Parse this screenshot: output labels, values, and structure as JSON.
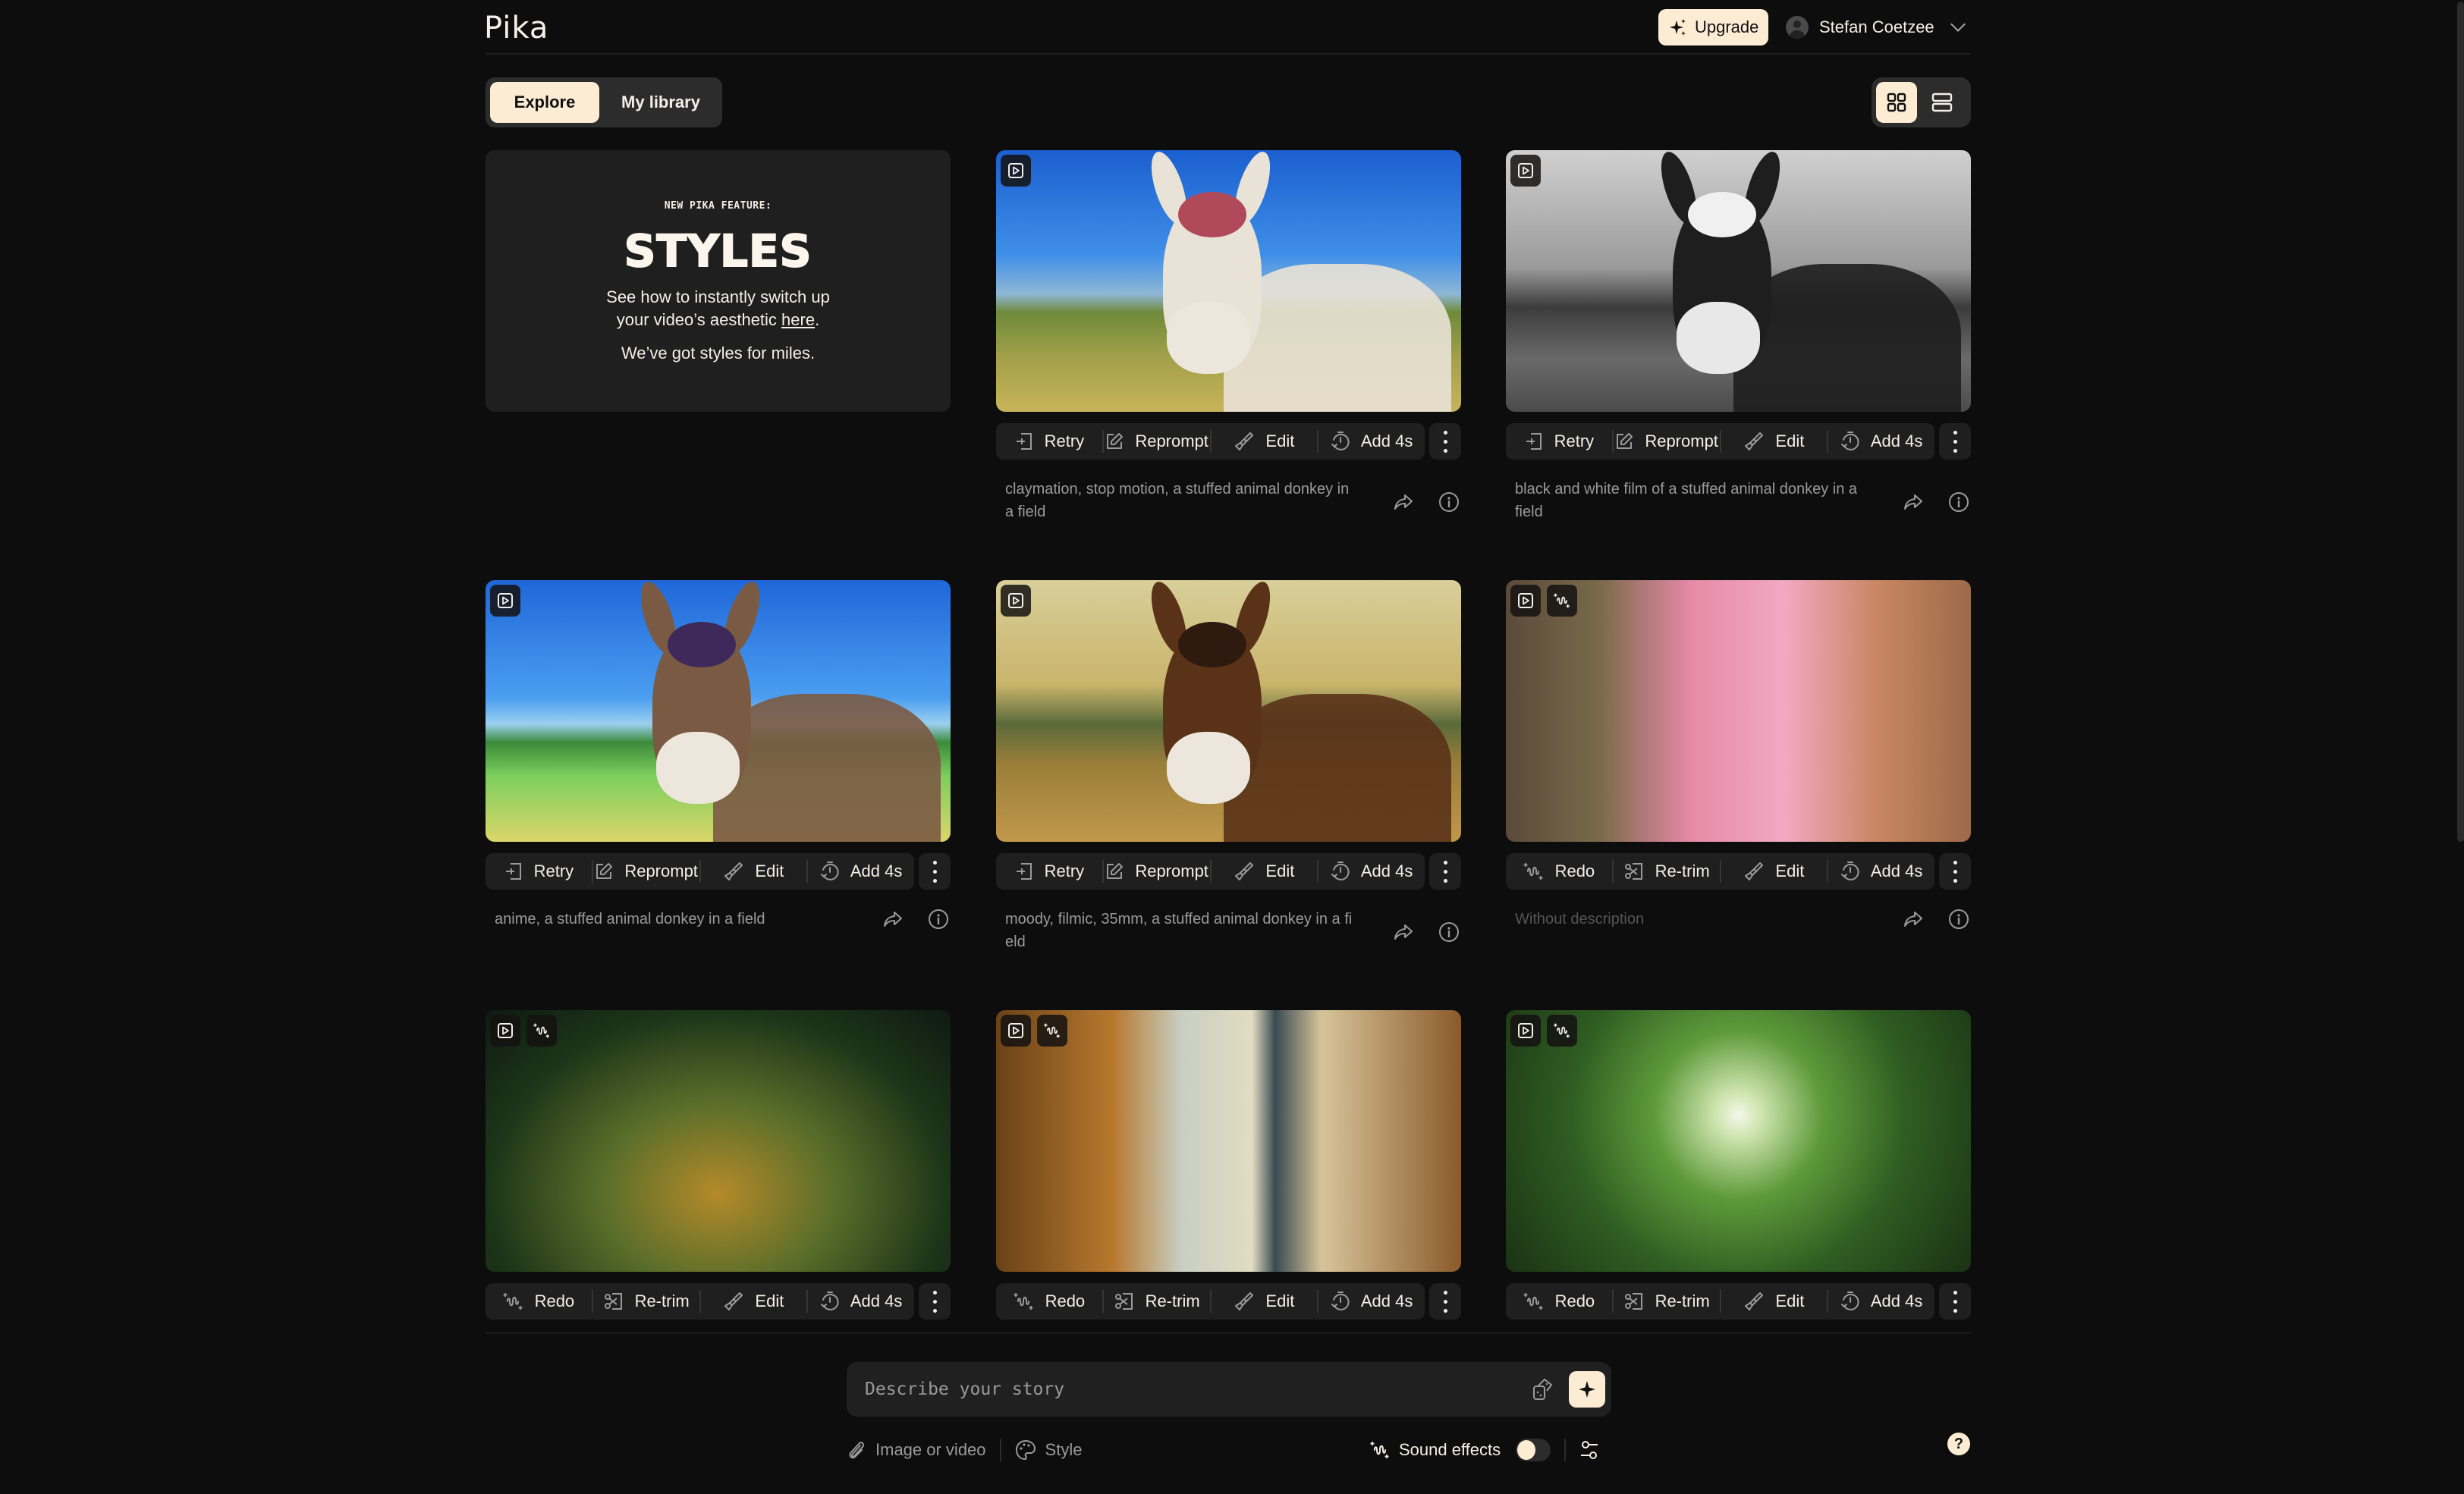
{
  "app": {
    "logo": "Pika",
    "upgrade_label": "Upgrade",
    "user_name": "Stefan Coetzee"
  },
  "tabs": [
    {
      "label": "Explore",
      "active": true
    },
    {
      "label": "My library",
      "active": false
    }
  ],
  "view_toggle": {
    "active": "grid",
    "options": [
      "grid-view",
      "list-view"
    ]
  },
  "promo": {
    "kicker": "NEW PIKA FEATURE:",
    "title": "STYLES",
    "body_line1": "See how to instantly switch up",
    "body_line2_prefix": "your video’s aesthetic ",
    "link": "here",
    "body_line2_suffix": ".",
    "footer": "We’ve got styles for miles."
  },
  "cards": [
    {
      "scene": "claymation-donkey",
      "badges": [
        "video-icon"
      ],
      "actions": [
        "Retry",
        "Reprompt",
        "Edit",
        "Add 4s"
      ],
      "description": "claymation, stop motion, a stuffed animal donkey in a field"
    },
    {
      "scene": "bw-donkey",
      "badges": [
        "video-icon"
      ],
      "actions": [
        "Retry",
        "Reprompt",
        "Edit",
        "Add 4s"
      ],
      "description": "black and white film of a stuffed animal donkey in a field"
    },
    {
      "scene": "anime-donkey",
      "badges": [
        "video-icon"
      ],
      "actions": [
        "Retry",
        "Reprompt",
        "Edit",
        "Add 4s"
      ],
      "description": "anime, a stuffed animal donkey in a field"
    },
    {
      "scene": "moody-donkey",
      "badges": [
        "video-icon"
      ],
      "actions": [
        "Retry",
        "Reprompt",
        "Edit",
        "Add 4s"
      ],
      "description": "moody, filmic, 35mm, a stuffed animal donkey in a field"
    },
    {
      "scene": "pink-waterfall",
      "badges": [
        "video-icon",
        "sound-icon"
      ],
      "actions": [
        "Redo",
        "Re-trim",
        "Edit",
        "Add 4s"
      ],
      "description": "Without description"
    },
    {
      "scene": "butterfly-meadow",
      "badges": [
        "video-icon",
        "sound-icon"
      ],
      "actions": [
        "Redo",
        "Re-trim",
        "Edit",
        "Add 4s"
      ],
      "description": ""
    },
    {
      "scene": "window-curtains",
      "badges": [
        "video-icon",
        "sound-icon"
      ],
      "actions": [
        "Redo",
        "Re-trim",
        "Edit",
        "Add 4s"
      ],
      "description": ""
    },
    {
      "scene": "forest-canopy",
      "badges": [
        "video-icon",
        "sound-icon"
      ],
      "actions": [
        "Redo",
        "Re-trim",
        "Edit",
        "Add 4s"
      ],
      "description": ""
    }
  ],
  "prompt": {
    "placeholder": "Describe your story",
    "value": ""
  },
  "tools": {
    "attach_label": "Image or video",
    "style_label": "Style",
    "sound_label": "Sound effects",
    "sound_enabled": false
  },
  "help_label": "?",
  "colors": {
    "background": "#0d0d0d",
    "surface": "#1f1f1f",
    "accent": "#fdecd4",
    "text": "#f3f0ea",
    "muted": "#9a9a9a"
  }
}
